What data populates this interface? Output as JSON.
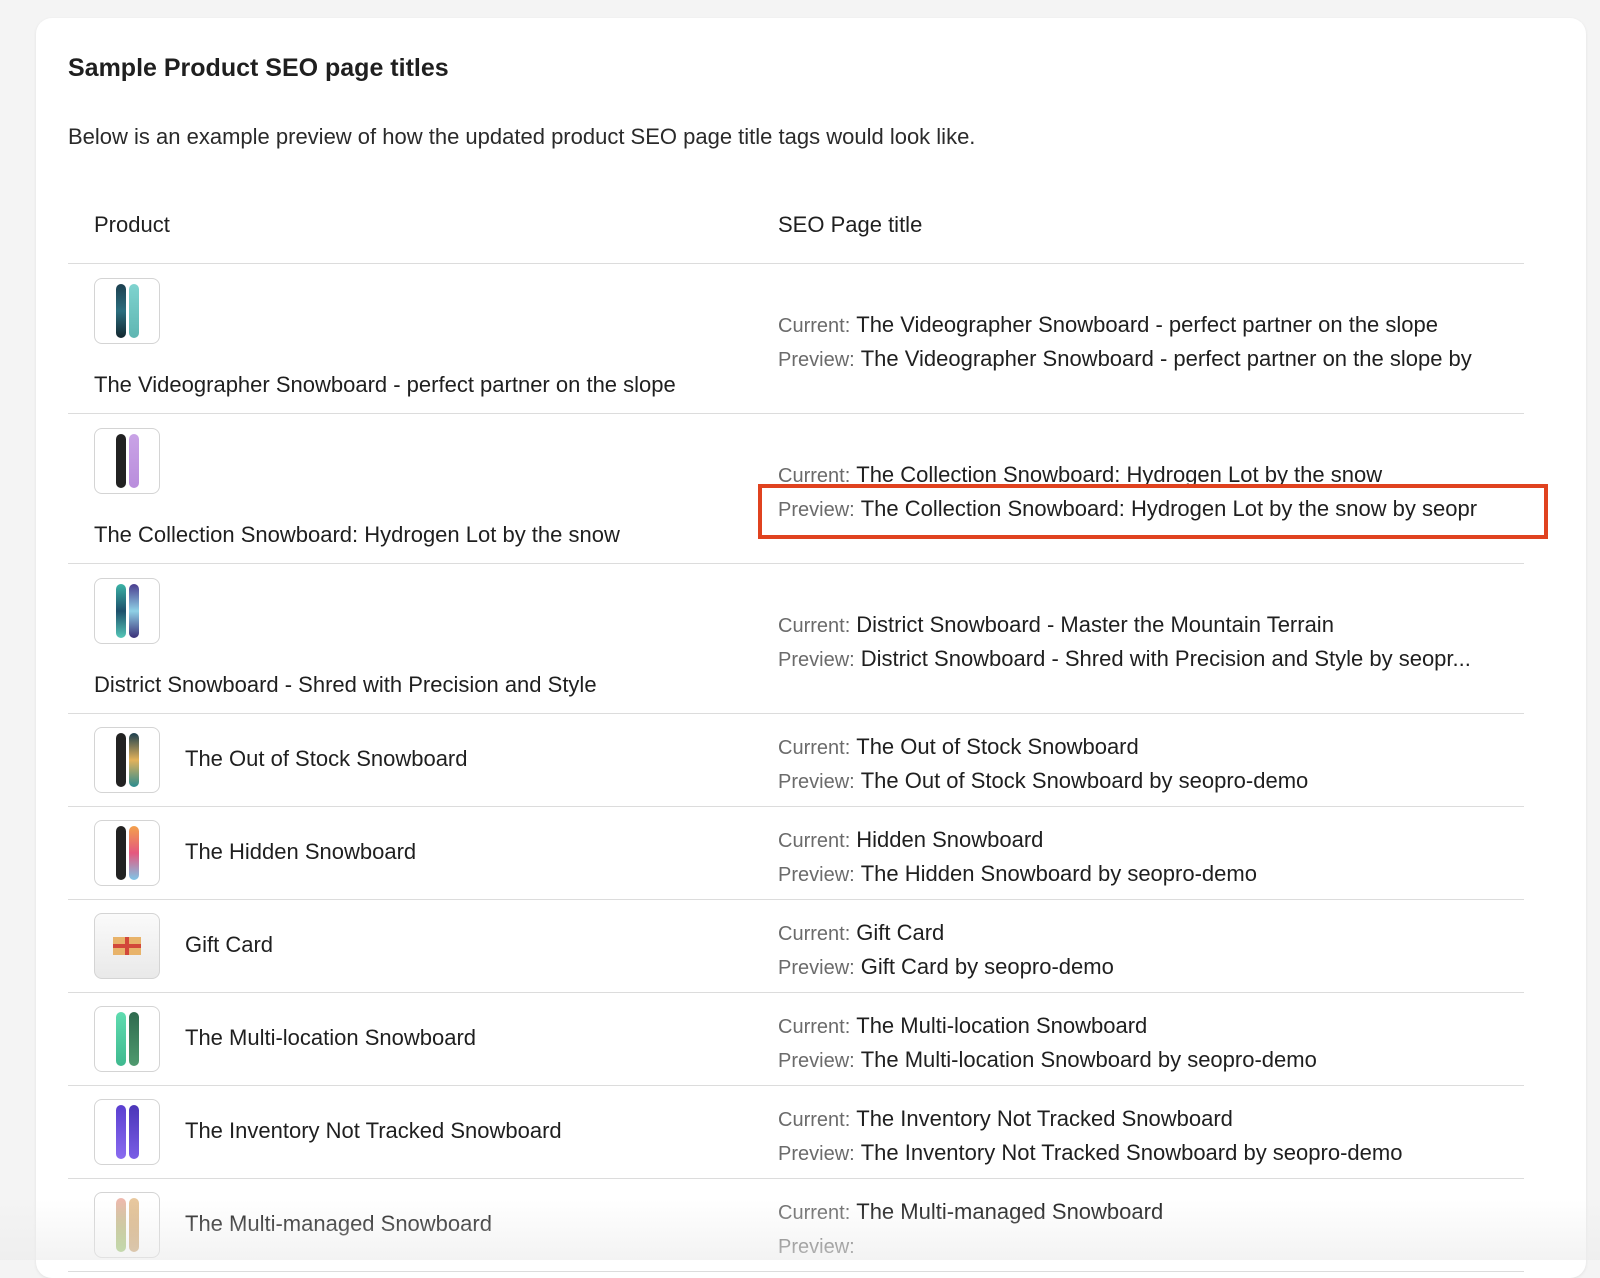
{
  "card": {
    "title": "Sample Product SEO page titles",
    "description": "Below is an example preview of how the updated product SEO page title tags would look like."
  },
  "table": {
    "headers": {
      "product": "Product",
      "seo": "SEO Page title"
    },
    "current_label": "Current:",
    "preview_label": "Preview:",
    "rows": [
      {
        "product": "The Videographer Snowboard - perfect partner on the slope",
        "current": "The Videographer Snowboard - perfect partner on the slope",
        "preview": "The Videographer Snowboard - perfect partner on the slope by",
        "image_icon": "snowboard-image-icon"
      },
      {
        "product": "The Collection Snowboard: Hydrogen Lot by the snow",
        "current": "The Collection Snowboard: Hydrogen Lot by the snow",
        "preview": "The Collection Snowboard: Hydrogen Lot by the snow by seopr",
        "image_icon": "snowboard-image-icon"
      },
      {
        "product": "District Snowboard - Shred with Precision and Style",
        "current": "District Snowboard - Master the Mountain Terrain",
        "preview": "District Snowboard - Shred with Precision and Style by seopr...",
        "image_icon": "snowboard-image-icon"
      },
      {
        "product": "The Out of Stock Snowboard",
        "current": "The Out of Stock Snowboard",
        "preview": "The Out of Stock Snowboard by seopro-demo",
        "image_icon": "snowboard-image-icon"
      },
      {
        "product": "The Hidden Snowboard",
        "current": "Hidden Snowboard",
        "preview": "The Hidden Snowboard by seopro-demo",
        "image_icon": "snowboard-image-icon"
      },
      {
        "product": "Gift Card",
        "current": "Gift Card",
        "preview": "Gift Card by seopro-demo",
        "image_icon": "gift-card-image-icon"
      },
      {
        "product": "The Multi-location Snowboard",
        "current": "The Multi-location Snowboard",
        "preview": "The Multi-location Snowboard by seopro-demo",
        "image_icon": "snowboard-image-icon"
      },
      {
        "product": "The Inventory Not Tracked Snowboard",
        "current": "The Inventory Not Tracked Snowboard",
        "preview": "The Inventory Not Tracked Snowboard by seopro-demo",
        "image_icon": "snowboard-image-icon"
      },
      {
        "product": "The Multi-managed Snowboard",
        "current": "The Multi-managed Snowboard",
        "preview": "",
        "image_icon": "snowboard-image-icon"
      }
    ]
  },
  "colors": {
    "highlight_border": "#e0421f",
    "label_gray": "#6b6b6b",
    "divider": "#dcdcdc"
  }
}
